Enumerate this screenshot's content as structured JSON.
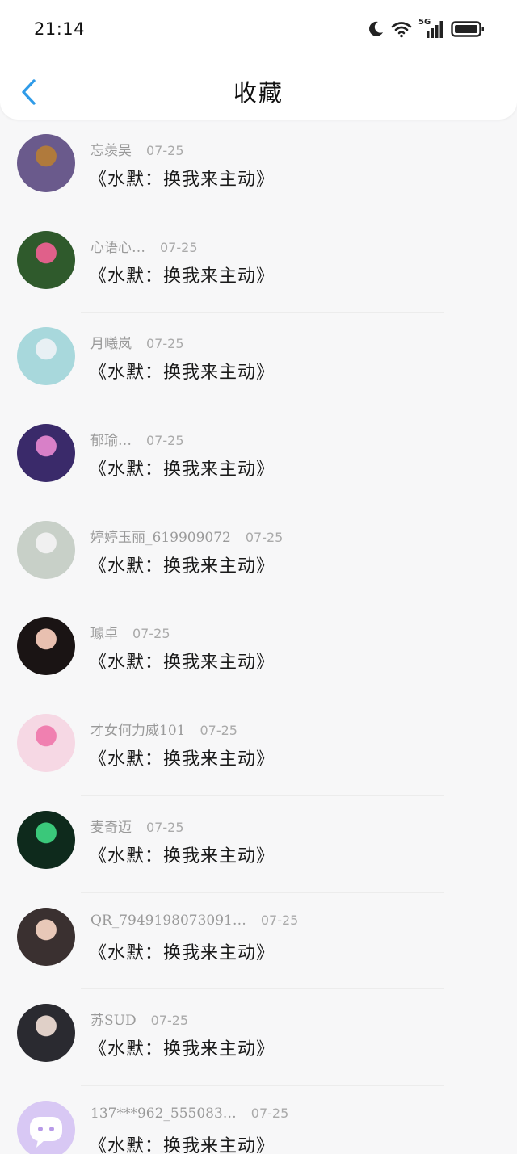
{
  "status_bar": {
    "time": "21:14",
    "icons": [
      "moon-icon",
      "wifi-icon",
      "signal-5g-icon",
      "battery-icon"
    ],
    "network_label": "5G"
  },
  "header": {
    "title": "收藏",
    "back_icon": "chevron-left-icon",
    "accent_color": "#2f9be8"
  },
  "favorites": [
    {
      "name": "忘羡吴",
      "date": "07-25",
      "title": "《水默：换我来主动》",
      "avatar": {
        "bg": "#6a5a8c",
        "accent": "#b07a3c"
      }
    },
    {
      "name": "心语心…",
      "date": "07-25",
      "title": "《水默：换我来主动》",
      "avatar": {
        "bg": "#2f5a2c",
        "accent": "#e0608a"
      }
    },
    {
      "name": "月曦岚",
      "date": "07-25",
      "title": "《水默：换我来主动》",
      "avatar": {
        "bg": "#a8d8dc",
        "accent": "#e8f0f4"
      }
    },
    {
      "name": "郁瑜…",
      "date": "07-25",
      "title": "《水默：换我来主动》",
      "avatar": {
        "bg": "#3a2a6a",
        "accent": "#d880c8"
      }
    },
    {
      "name": "婷婷玉丽_619909072",
      "date": "07-25",
      "title": "《水默：换我来主动》",
      "avatar": {
        "bg": "#c8d0c8",
        "accent": "#f0f0f0"
      }
    },
    {
      "name": "璩卓",
      "date": "07-25",
      "title": "《水默：换我来主动》",
      "avatar": {
        "bg": "#1a1414",
        "accent": "#e8c0b0"
      }
    },
    {
      "name": "才女何力威101",
      "date": "07-25",
      "title": "《水默：换我来主动》",
      "avatar": {
        "bg": "#f6d8e4",
        "accent": "#f080b0"
      }
    },
    {
      "name": "麦奇迈",
      "date": "07-25",
      "title": "《水默：换我来主动》",
      "avatar": {
        "bg": "#0e2a1c",
        "accent": "#3ac87a"
      }
    },
    {
      "name": "QR_7949198073091…",
      "date": "07-25",
      "title": "《水默：换我来主动》",
      "avatar": {
        "bg": "#3a3030",
        "accent": "#e8c8b8"
      }
    },
    {
      "name": "苏SUD",
      "date": "07-25",
      "title": "《水默：换我来主动》",
      "avatar": {
        "bg": "#2a2a30",
        "accent": "#e0d0c8"
      }
    },
    {
      "name": "137***962_555083…",
      "date": "07-25",
      "title": "《水默：换我来主动》",
      "avatar": {
        "bg": "#d8c8f4",
        "accent": "#ffffff"
      }
    }
  ]
}
